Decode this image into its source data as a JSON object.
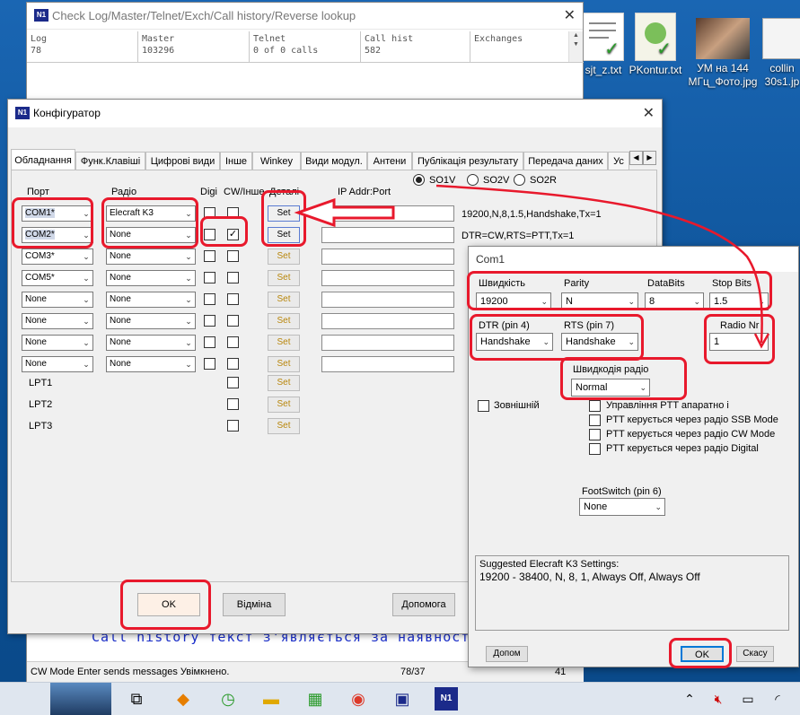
{
  "back_window": {
    "title": "Check Log/Master/Telnet/Exch/Call history/Reverse lookup",
    "columns": [
      {
        "label": "Log",
        "value": "78"
      },
      {
        "label": "Master",
        "value": "103296"
      },
      {
        "label": "Telnet",
        "value": "0 of 0 calls"
      },
      {
        "label": "Call hist",
        "value": "582"
      },
      {
        "label": "Exchanges",
        "value": ""
      }
    ],
    "call_history_text": "Call history текст з'являється за наявності.",
    "status_left": "CW Mode Enter sends messages Увімкнено.",
    "status_mid": "78/37",
    "status_right": "41"
  },
  "desktop_icons": [
    {
      "label": "sjt_z.txt"
    },
    {
      "label": "PKontur.txt"
    },
    {
      "label": "УМ на 144 МГц_Фото.jpg"
    },
    {
      "label": "collin 30s1.jp"
    }
  ],
  "configurator": {
    "title": "Конфігуратор",
    "tabs": [
      "Обладнання",
      "Функ.Клавіші",
      "Цифрові види",
      "Інше",
      "Winkey",
      "Види модул.",
      "Антени",
      "Публікація результату",
      "Передача даних",
      "Ус"
    ],
    "radio_options": [
      "SO1V",
      "SO2V",
      "SO2R"
    ],
    "headers": {
      "port": "Порт",
      "radio": "Радіо",
      "digi": "Digi",
      "cw": "CW/Інше",
      "details": "Деталі",
      "ip": "IP Addr:Port"
    },
    "rows": [
      {
        "port": "COM1*",
        "radio": "Elecraft K3",
        "digi": false,
        "cw": false,
        "set": "Set",
        "info": "19200,N,8,1.5,Handshake,Tx=1"
      },
      {
        "port": "COM2*",
        "radio": "None",
        "digi": false,
        "cw": true,
        "set": "Set",
        "info": "DTR=CW,RTS=PTT,Tx=1"
      },
      {
        "port": "COM3*",
        "radio": "None",
        "digi": false,
        "cw": false,
        "set": "Set",
        "info": ""
      },
      {
        "port": "COM5*",
        "radio": "None",
        "digi": false,
        "cw": false,
        "set": "Set",
        "info": ""
      },
      {
        "port": "None",
        "radio": "None",
        "digi": false,
        "cw": false,
        "set": "Set",
        "info": ""
      },
      {
        "port": "None",
        "radio": "None",
        "digi": false,
        "cw": false,
        "set": "Set",
        "info": ""
      },
      {
        "port": "None",
        "radio": "None",
        "digi": false,
        "cw": false,
        "set": "Set",
        "info": ""
      },
      {
        "port": "None",
        "radio": "None",
        "digi": false,
        "cw": false,
        "set": "Set",
        "info": ""
      }
    ],
    "lpt": [
      {
        "label": "LPT1",
        "set": "Set"
      },
      {
        "label": "LPT2",
        "set": "Set"
      },
      {
        "label": "LPT3",
        "set": "Set"
      }
    ],
    "ok_label": "OK",
    "cancel_label": "Відміна",
    "help_label": "Допомога"
  },
  "com1": {
    "title": "Com1",
    "speed_label": "Швидкість",
    "speed_value": "19200",
    "parity_label": "Parity",
    "parity_value": "N",
    "databits_label": "DataBits",
    "databits_value": "8",
    "stopbits_label": "Stop Bits",
    "stopbits_value": "1.5",
    "dtr_label": "DTR (pin 4)",
    "dtr_value": "Handshake",
    "rts_label": "RTS (pin 7)",
    "rts_value": "Handshake",
    "radionr_label": "Radio Nr",
    "radionr_value": "1",
    "radiospeed_label": "Швидкодія радіо",
    "radiospeed_value": "Normal",
    "external_label": "Зовнішній",
    "ptt_options": [
      "Управління PTT апаратно і",
      "PTT керується через радіо SSB Mode",
      "PTT керується через радіо CW Mode",
      "PTT керується через радіо Digital"
    ],
    "footswitch_label": "FootSwitch (pin 6)",
    "footswitch_value": "None",
    "suggested_title": "Suggested Elecraft K3 Settings:",
    "suggested_text": "19200 - 38400, N, 8, 1, Always Off, Always Off",
    "help_label": "Допом",
    "ok_label": "OK",
    "cancel_label": "Скасу"
  },
  "colors": {
    "highlight_red": "#e8192c",
    "call_history_blue": "#1a2ecc"
  }
}
